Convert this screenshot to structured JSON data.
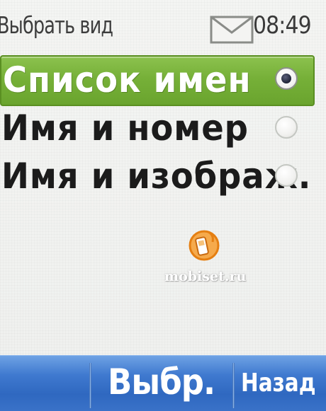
{
  "status_bar": {
    "title": "Выбрать вид",
    "message_icon": "envelope-icon",
    "time": "08:49"
  },
  "list": {
    "items": [
      {
        "label": "Список имен",
        "selected": true
      },
      {
        "label": "Имя и номер",
        "selected": false
      },
      {
        "label": "Имя и изображ.",
        "selected": false
      }
    ]
  },
  "watermark": {
    "logo_icon": "mobile-phone-logo-icon",
    "text": "mobiset.ru"
  },
  "softkeys": {
    "select_label": "Выбр.",
    "back_label": "Назад"
  },
  "colors": {
    "selection_green": "#76b038",
    "softkey_blue": "#3f79cf",
    "watermark_orange": "#f08a1c"
  }
}
